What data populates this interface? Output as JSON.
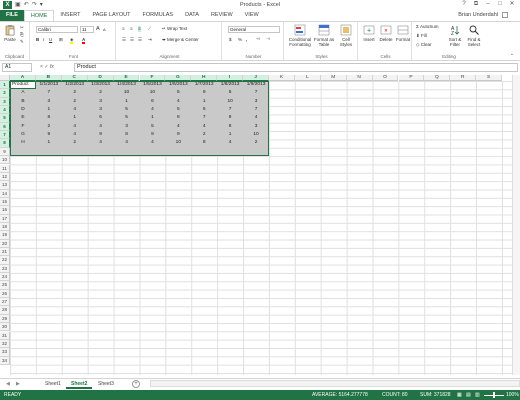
{
  "window": {
    "title": "Products - Excel",
    "user": "Brian Underdahl"
  },
  "qat": {
    "save_icon": "save-icon",
    "undo_icon": "undo-icon",
    "redo_icon": "redo-icon"
  },
  "tabs": [
    "FILE",
    "HOME",
    "INSERT",
    "PAGE LAYOUT",
    "FORMULAS",
    "DATA",
    "REVIEW",
    "VIEW"
  ],
  "ribbon": {
    "clipboard": {
      "label": "Clipboard",
      "paste": "Paste"
    },
    "font": {
      "label": "Font",
      "name": "Calibri",
      "size": "11",
      "bold": "B",
      "italic": "I",
      "underline": "U",
      "grow": "A",
      "shrink": "A"
    },
    "alignment": {
      "label": "Alignment",
      "wrap": "Wrap Text",
      "merge": "Merge & Center"
    },
    "number": {
      "label": "Number",
      "format": "General",
      "currency": "$",
      "percent": "%",
      "comma": ","
    },
    "styles": {
      "label": "Styles",
      "conditional": "Conditional Formatting",
      "format_table": "Format as Table",
      "cell_styles": "Cell Styles"
    },
    "cells": {
      "label": "Cells",
      "insert": "Insert",
      "delete": "Delete",
      "format": "Format"
    },
    "editing": {
      "label": "Editing",
      "autosum": "AutoSum",
      "fill": "Fill",
      "clear": "Clear",
      "sort": "Sort & Filter",
      "find": "Find & Select"
    }
  },
  "formula_bar": {
    "name_box": "A1",
    "fx": "fx",
    "content": "Product",
    "cancel": "×",
    "enter": "✓"
  },
  "columns": [
    "A",
    "B",
    "C",
    "D",
    "E",
    "F",
    "G",
    "H",
    "I",
    "J",
    "K",
    "L",
    "M",
    "N",
    "O",
    "P",
    "Q",
    "R",
    "S"
  ],
  "rows": 34,
  "grid": {
    "header": [
      "Product",
      "1/1/2013",
      "1/2/2013",
      "1/3/2013",
      "1/4/2013",
      "1/5/2013",
      "1/6/2013",
      "1/7/2013",
      "1/8/2013",
      "1/9/2013"
    ],
    "data": [
      [
        "A",
        "7",
        "2",
        "2",
        "10",
        "10",
        "5",
        "9",
        "5",
        "7"
      ],
      [
        "B",
        "3",
        "2",
        "3",
        "1",
        "6",
        "4",
        "1",
        "10",
        "3"
      ],
      [
        "D",
        "1",
        "4",
        "3",
        "5",
        "4",
        "5",
        "6",
        "7",
        "7"
      ],
      [
        "E",
        "8",
        "1",
        "6",
        "5",
        "1",
        "8",
        "7",
        "8",
        "4"
      ],
      [
        "F",
        "2",
        "4",
        "4",
        "3",
        "5",
        "4",
        "4",
        "8",
        "3"
      ],
      [
        "G",
        "9",
        "4",
        "9",
        "8",
        "9",
        "9",
        "2",
        "1",
        "10"
      ],
      [
        "H",
        "1",
        "2",
        "4",
        "4",
        "4",
        "10",
        "8",
        "4",
        "2"
      ]
    ]
  },
  "sheets": [
    "Sheet1",
    "Sheet2",
    "Sheet3"
  ],
  "active_sheet": "Sheet2",
  "status": {
    "ready": "READY",
    "average": "AVERAGE: 5164.277778",
    "count": "COUNT: 80",
    "sum": "SUM: 371828",
    "zoom": "100%"
  },
  "colors": {
    "accent": "#217346",
    "selection": "#c9c9c9"
  }
}
